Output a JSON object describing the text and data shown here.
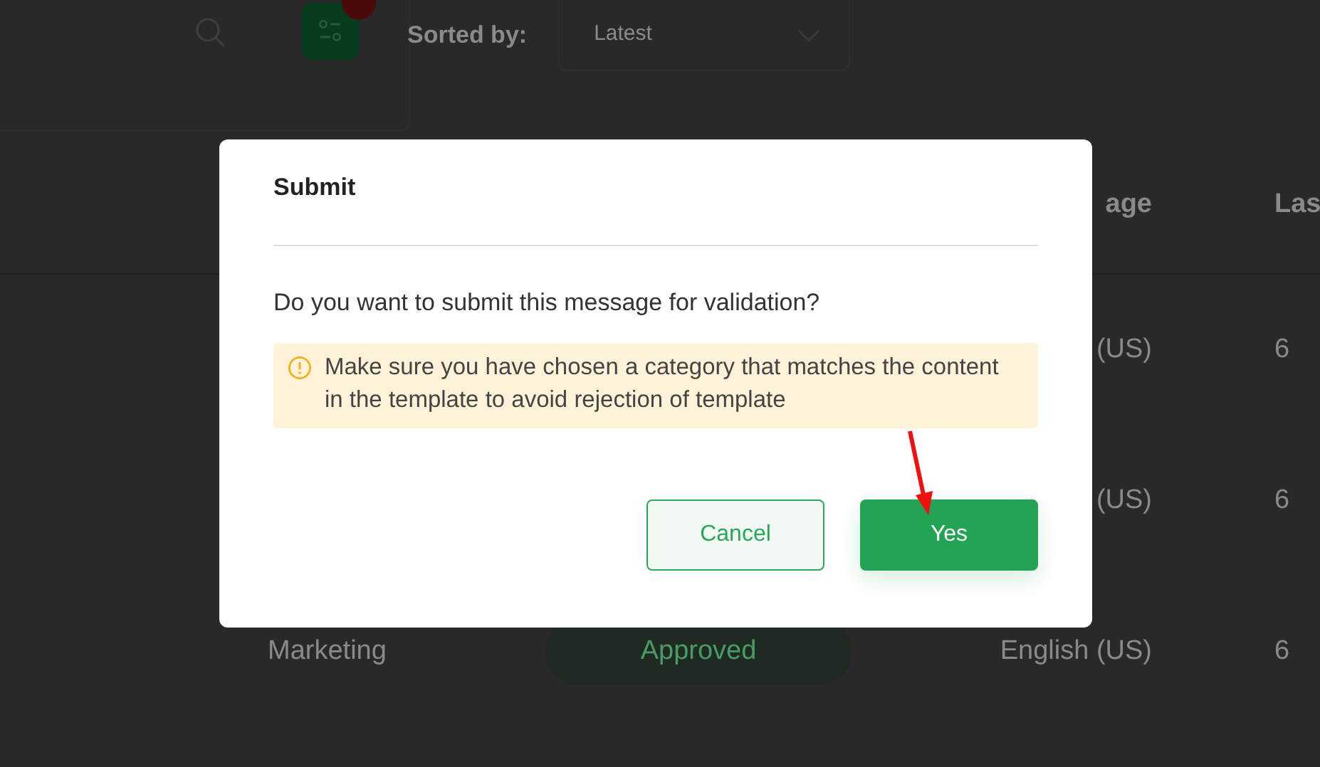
{
  "toolbar": {
    "sorted_by_label": "Sorted by:",
    "sort_select": {
      "value": "Latest"
    }
  },
  "table": {
    "columns": [
      "age",
      "Las"
    ],
    "rows": [
      {
        "language": "(US)",
        "column_4": "6"
      },
      {
        "language": "(US)",
        "column_4": "6"
      },
      {
        "category": "Marketing",
        "status": "Approved",
        "language": "English (US)",
        "column_4": "6"
      }
    ]
  },
  "dialog": {
    "title": "Submit",
    "question": "Do you want to submit this message for validation?",
    "warning": "Make sure you have chosen a category that matches the content in the template to avoid rejection of template",
    "buttons": [
      {
        "label": "Cancel",
        "kind": "secondary"
      },
      {
        "label": "Yes",
        "kind": "primary"
      }
    ]
  }
}
